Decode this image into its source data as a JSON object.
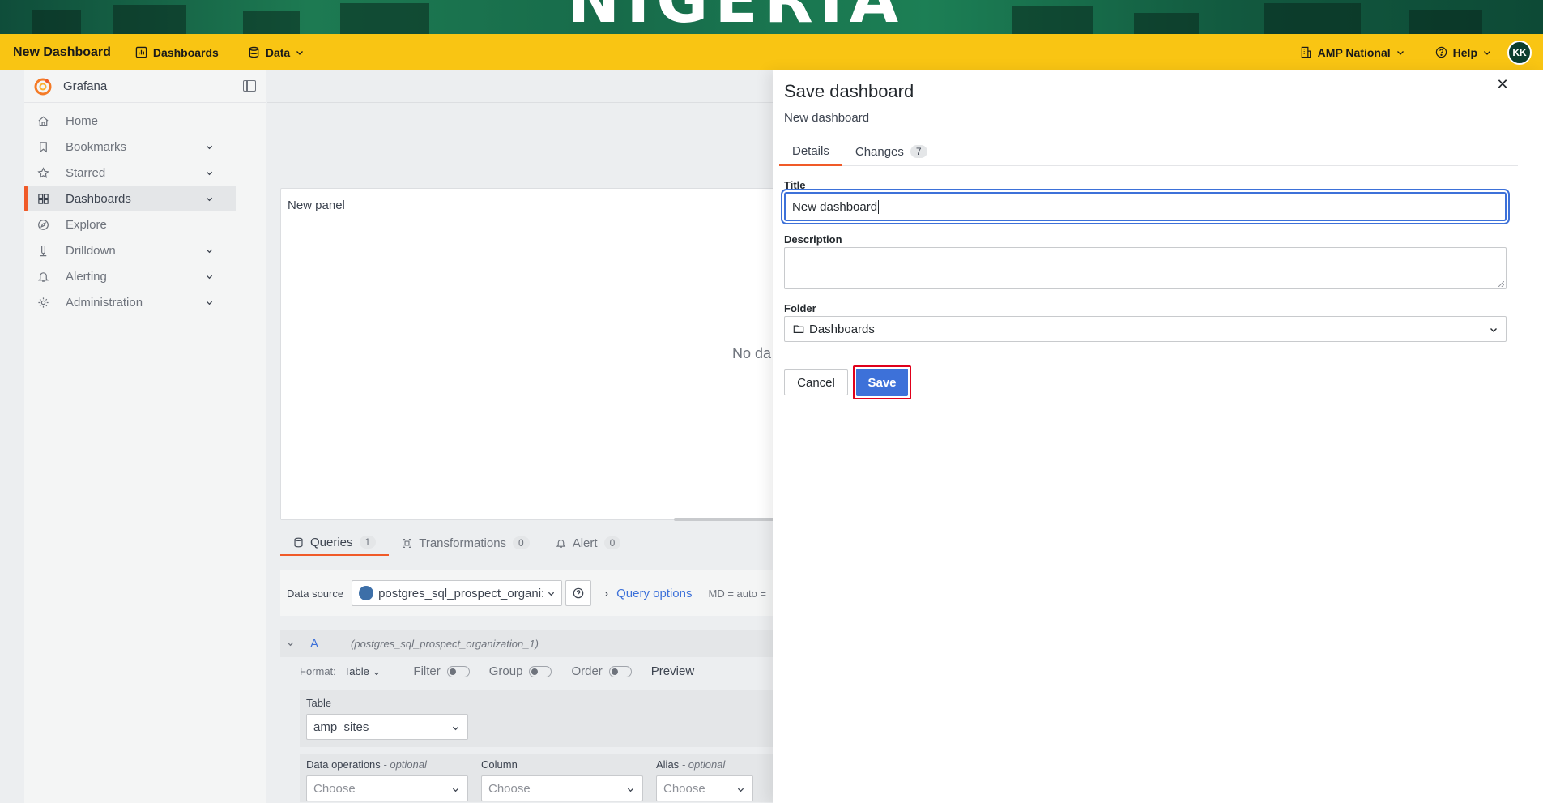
{
  "banner": {
    "text": "NIGERIA"
  },
  "topnav": {
    "brand": "New Dashboard",
    "items": [
      {
        "label": "Dashboards",
        "icon": "bar-chart-icon"
      },
      {
        "label": "Data",
        "icon": "database-icon"
      }
    ],
    "org": "AMP National",
    "help": "Help",
    "avatar": "KK"
  },
  "sidebar": {
    "app_name": "Grafana",
    "items": [
      {
        "label": "Home",
        "icon": "home-icon",
        "expandable": false
      },
      {
        "label": "Bookmarks",
        "icon": "bookmark-icon",
        "expandable": true
      },
      {
        "label": "Starred",
        "icon": "star-icon",
        "expandable": true
      },
      {
        "label": "Dashboards",
        "icon": "apps-icon",
        "expandable": true,
        "active": true
      },
      {
        "label": "Explore",
        "icon": "compass-icon",
        "expandable": false
      },
      {
        "label": "Drilldown",
        "icon": "drilldown-icon",
        "expandable": true
      },
      {
        "label": "Alerting",
        "icon": "bell-icon",
        "expandable": true
      },
      {
        "label": "Administration",
        "icon": "cog-icon",
        "expandable": true
      }
    ]
  },
  "editor": {
    "panel_title": "New panel",
    "no_data": "No da",
    "tabs": [
      {
        "label": "Queries",
        "count": "1"
      },
      {
        "label": "Transformations",
        "count": "0"
      },
      {
        "label": "Alert",
        "count": "0"
      }
    ],
    "datasource_label": "Data source",
    "datasource_value": "postgres_sql_prospect_organi:",
    "query_options": "Query options",
    "md": "MD = auto =",
    "query_letter": "A",
    "query_ds": "(postgres_sql_prospect_organization_1)",
    "format_label": "Format:",
    "format_value": "Table",
    "filter_label": "Filter",
    "group_label": "Group",
    "order_label": "Order",
    "preview_label": "Preview",
    "table_label": "Table",
    "table_value": "amp_sites",
    "ops": {
      "data_ops_label": "Data operations",
      "column_label": "Column",
      "alias_label": "Alias",
      "optional": "- optional",
      "choose": "Choose"
    }
  },
  "drawer": {
    "title": "Save dashboard",
    "subtitle": "New dashboard",
    "tabs": [
      {
        "label": "Details",
        "active": true
      },
      {
        "label": "Changes",
        "count": "7"
      }
    ],
    "title_label": "Title",
    "title_value": "New dashboard",
    "description_label": "Description",
    "description_value": "",
    "folder_label": "Folder",
    "folder_value": "Dashboards",
    "cancel": "Cancel",
    "save": "Save",
    "close_icon": "close-icon"
  },
  "colors": {
    "topnav_bg": "#f9c513",
    "accent_orange": "#f05a28",
    "primary_blue": "#3d71d9",
    "highlight_red": "#e0001b"
  }
}
